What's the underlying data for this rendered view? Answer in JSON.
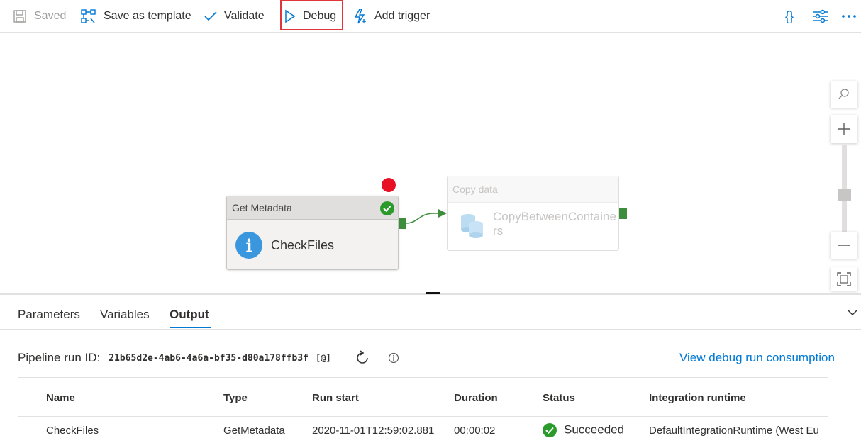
{
  "toolbar": {
    "saved_label": "Saved",
    "save_template_label": "Save as template",
    "validate_label": "Validate",
    "debug_label": "Debug",
    "add_trigger_label": "Add trigger",
    "code_label": "{}"
  },
  "canvas": {
    "get_metadata": {
      "type": "Get Metadata",
      "name": "CheckFiles"
    },
    "copy_data": {
      "type": "Copy data",
      "name_line1": "CopyBetweenContaine",
      "name_line2": "rs"
    }
  },
  "tabs": [
    {
      "label": "Parameters"
    },
    {
      "label": "Variables"
    },
    {
      "label": "Output"
    }
  ],
  "run": {
    "label": "Pipeline run ID:",
    "id": "21b65d2e-4ab6-4a6a-bf35-d80a178ffb3f",
    "copy_label": "[@]",
    "consumption_link": "View debug run consumption"
  },
  "table": {
    "headers": [
      "Name",
      "Type",
      "Run start",
      "Duration",
      "Status",
      "Integration runtime"
    ],
    "rows": [
      {
        "name": "CheckFiles",
        "type": "GetMetadata",
        "run_start": "2020-11-01T12:59:02.881",
        "duration": "00:00:02",
        "status": "Succeeded",
        "runtime": "DefaultIntegrationRuntime (West Eu"
      }
    ]
  },
  "colors": {
    "accent": "#0078d4",
    "success": "#2a9a2a",
    "error": "#e81123",
    "highlight": "#e0363a"
  }
}
